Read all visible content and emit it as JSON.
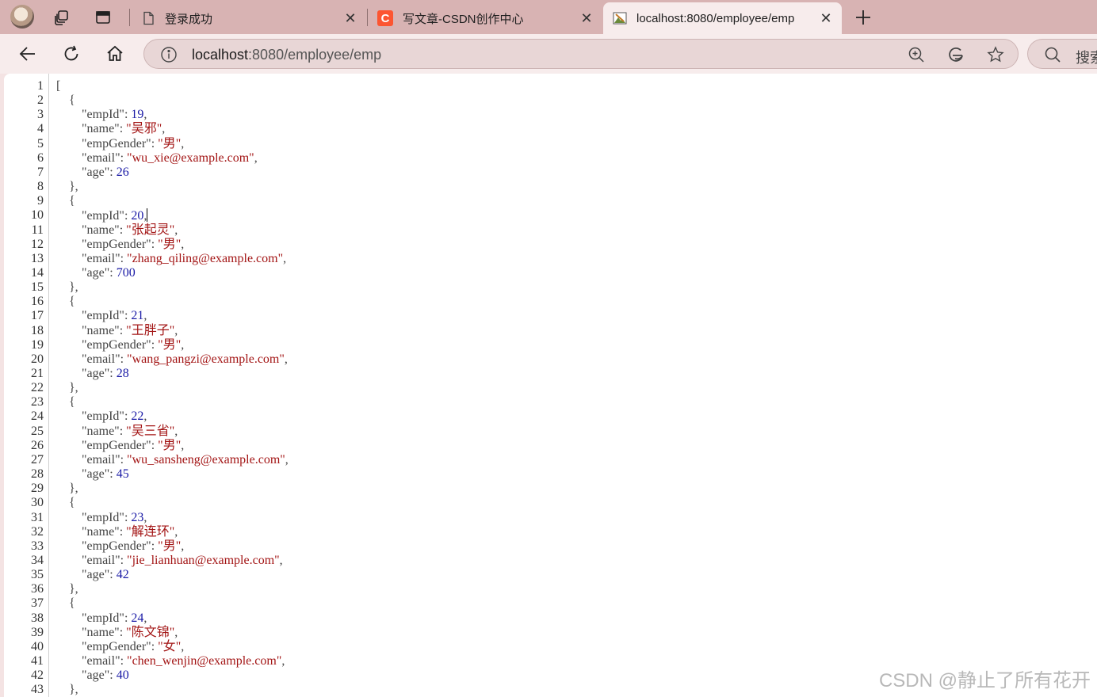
{
  "tabs": [
    {
      "title": "登录成功",
      "favicon": "page-icon"
    },
    {
      "title": "写文章-CSDN创作中心",
      "favicon": "csdn-icon",
      "favicon_letter": "C",
      "favicon_color": "#fc5531"
    },
    {
      "title": "localhost:8080/employee/emp",
      "favicon": "image-icon",
      "active": true
    }
  ],
  "tab_close_glyph": "✕",
  "address": {
    "host": "localhost",
    "rest": ":8080/employee/emp"
  },
  "search": {
    "label": "搜索"
  },
  "json_text": {
    "employees": [
      {
        "empId": "19",
        "name": "吴邪",
        "empGender": "男",
        "email": "wu_xie@example.com",
        "age": "26"
      },
      {
        "empId": "20",
        "name": "张起灵",
        "empGender": "男",
        "email": "zhang_qiling@example.com",
        "age": "700"
      },
      {
        "empId": "21",
        "name": "王胖子",
        "empGender": "男",
        "email": "wang_pangzi@example.com",
        "age": "28"
      },
      {
        "empId": "22",
        "name": "吴三省",
        "empGender": "男",
        "email": "wu_sansheng@example.com",
        "age": "45"
      },
      {
        "empId": "23",
        "name": "解连环",
        "empGender": "男",
        "email": "jie_lianhuan@example.com",
        "age": "42"
      },
      {
        "empId": "24",
        "name": "陈文锦",
        "empGender": "女",
        "email": "chen_wenjin@example.com",
        "age": "40"
      }
    ],
    "line_count": 43
  },
  "watermark": "CSDN @静止了所有花开",
  "colors": {
    "tabstrip": "#d8b3b3",
    "toolbar": "#f7ecec",
    "json_string": "#a31515",
    "json_number": "#1a1aa6"
  }
}
